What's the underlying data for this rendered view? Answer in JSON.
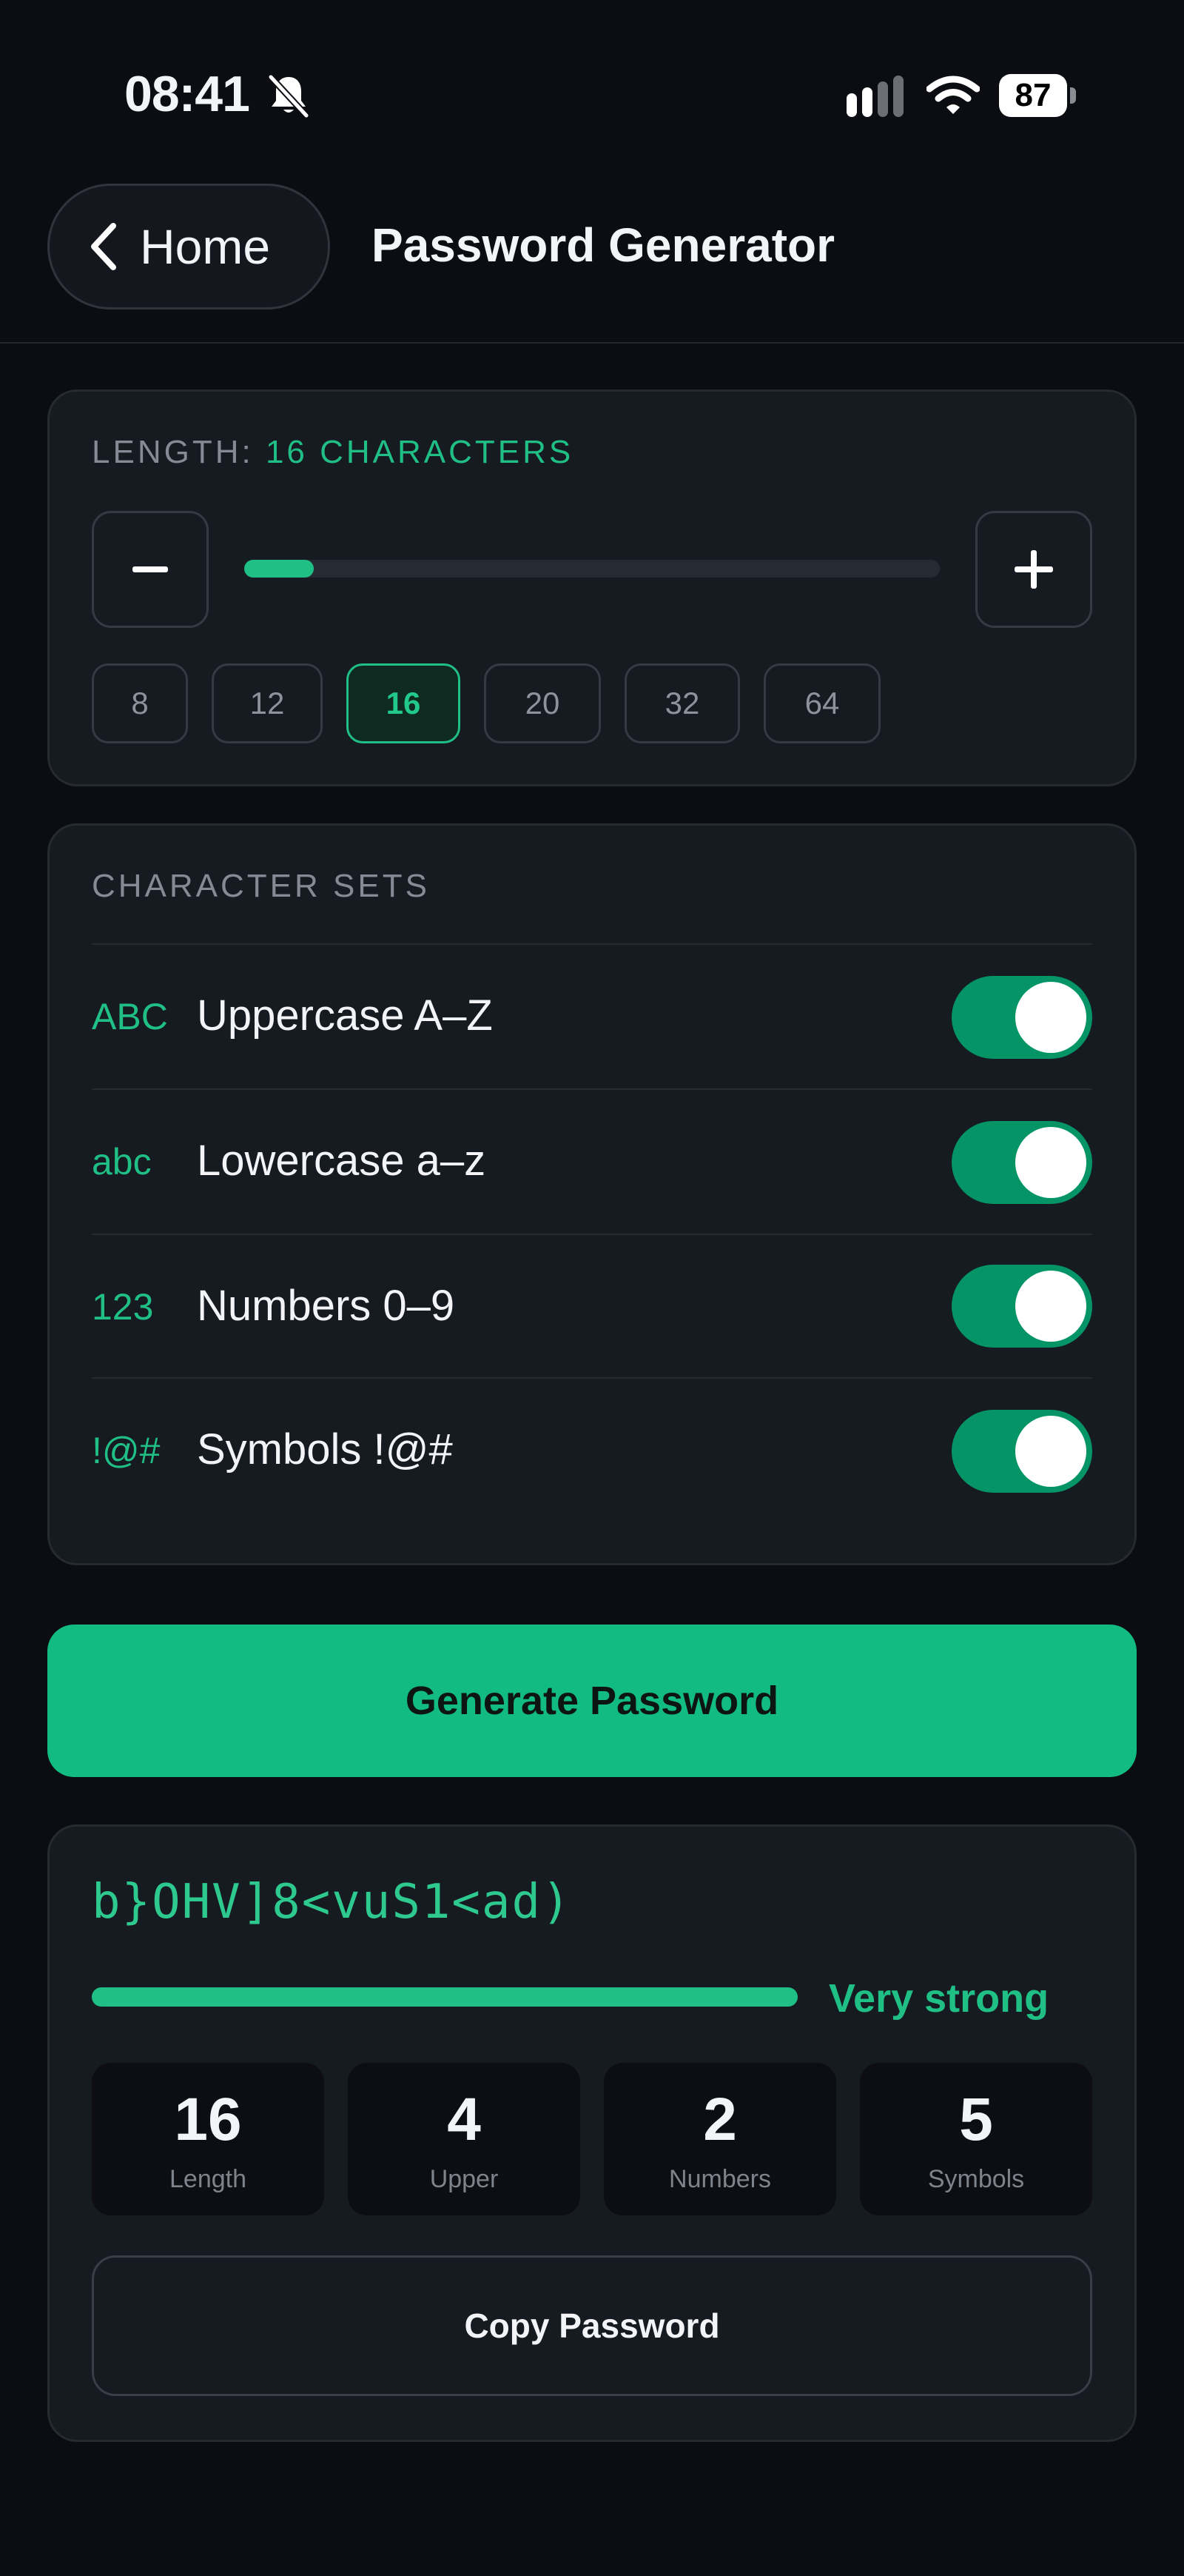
{
  "status_bar": {
    "time": "08:41",
    "battery": "87"
  },
  "header": {
    "back_label": "Home",
    "title": "Password Generator"
  },
  "length": {
    "label": "LENGTH:",
    "value_label": "16 CHARACTERS",
    "slider_fraction": 0.1,
    "presets": [
      "8",
      "12",
      "16",
      "20",
      "32",
      "64"
    ],
    "selected": "16"
  },
  "character_sets": {
    "label": "CHARACTER SETS",
    "items": [
      {
        "code": "ABC",
        "name": "Uppercase  A–Z",
        "enabled": true
      },
      {
        "code": "abc",
        "name": "Lowercase  a–z",
        "enabled": true
      },
      {
        "code": "123",
        "name": "Numbers  0–9",
        "enabled": true
      },
      {
        "code": "!@#",
        "name": "Symbols  !@#",
        "enabled": true
      }
    ]
  },
  "generate_label": "Generate Password",
  "result": {
    "password": "b}OHV]8<vuS1<ad)",
    "strength_label": "Very strong",
    "strength_fraction": 1.0,
    "stats": [
      {
        "value": "16",
        "label": "Length"
      },
      {
        "value": "4",
        "label": "Upper"
      },
      {
        "value": "2",
        "label": "Numbers"
      },
      {
        "value": "5",
        "label": "Symbols"
      }
    ],
    "copy_label": "Copy Password"
  },
  "colors": {
    "accent": "#1fbf86",
    "toggle_on": "#049466",
    "background": "#0b0d12",
    "card": "#161a21"
  }
}
